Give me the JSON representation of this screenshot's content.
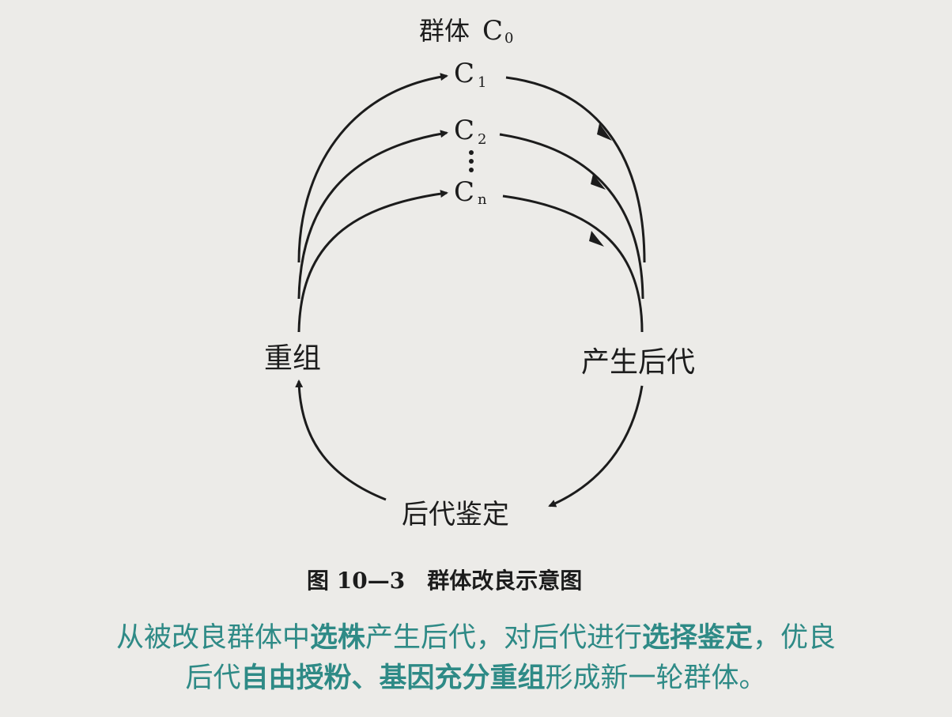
{
  "diagram": {
    "population_label": "群体",
    "population_sub": "0",
    "c_letter": "C",
    "c1_sub": "1",
    "c2_sub": "2",
    "cn_sub": "n",
    "recombine": "重组",
    "offspring": "产生后代",
    "identify": "后代鉴定",
    "figure_caption": "图 10—3　群体改良示意图"
  },
  "caption": {
    "line1": [
      {
        "text": "从被改良群体中",
        "bold": false
      },
      {
        "text": "选株",
        "bold": true
      },
      {
        "text": "产生后代，对后代进行",
        "bold": false
      },
      {
        "text": "选择鉴定",
        "bold": true
      },
      {
        "text": "，优良",
        "bold": false
      }
    ],
    "line2": [
      {
        "text": "后代",
        "bold": false
      },
      {
        "text": "自由授粉、基因充分重组",
        "bold": true
      },
      {
        "text": "形成新一轮群体。",
        "bold": false
      }
    ]
  },
  "colors": {
    "caption_text": "#2e8a86",
    "diagram_ink": "#1c1c1c",
    "background": "#ecebe8"
  }
}
